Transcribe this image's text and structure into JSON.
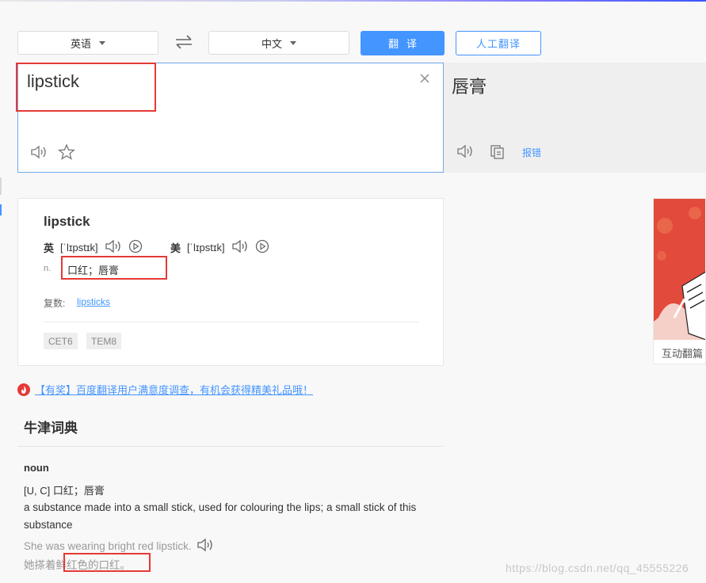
{
  "toolbar": {
    "source_lang": "英语",
    "target_lang": "中文",
    "translate_label": "翻译",
    "human_translate_label": "人工翻译"
  },
  "source": {
    "text": "lipstick"
  },
  "target": {
    "text": "唇膏",
    "report_label": "报错"
  },
  "dictionary": {
    "word": "lipstick",
    "uk": {
      "label": "英",
      "ipa": "[ˈlɪpstɪk]"
    },
    "us": {
      "label": "美",
      "ipa": "[ˈlɪpstɪk]"
    },
    "pos": "n.",
    "meaning": "口红；唇膏",
    "plural_label": "复数:",
    "plural": "lipsticks",
    "tags": [
      "CET6",
      "TEM8"
    ]
  },
  "ad": {
    "caption": "互动翻篇"
  },
  "survey": {
    "text": "【有奖】百度翻译用户满意度调查，有机会获得精美礼品哦！"
  },
  "oxford": {
    "title": "牛津词典",
    "pos": "noun",
    "grammar": "[U, C] 口红；唇膏",
    "definition": "a substance made into a small stick, used for colouring the lips; a small stick of this substance",
    "example_en": "She was wearing bright red lipstick.",
    "example_cn": "她搽着鲜红色的口红。"
  },
  "watermark": "https://blog.csdn.net/qq_45555226",
  "colors": {
    "accent": "#4395ff",
    "highlight": "#e53935"
  }
}
